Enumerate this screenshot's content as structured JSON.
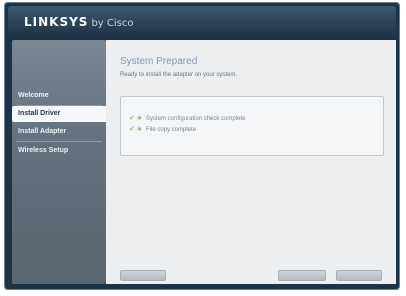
{
  "brand": {
    "logo_text": "LINKSYS",
    "logo_sub": "by Cisco"
  },
  "sidebar": {
    "items": [
      {
        "label": "Welcome"
      },
      {
        "label": "Install Driver"
      },
      {
        "label": "Install Adapter"
      },
      {
        "label": "Wireless Setup"
      }
    ]
  },
  "main": {
    "title": "System Prepared",
    "subtitle": "Ready to install the adapter on your system.",
    "status_items": [
      {
        "text": "System configuration check complete"
      },
      {
        "text": "File copy complete"
      }
    ]
  },
  "colors": {
    "accent": "#7f9bb6",
    "frame": "#1f3346",
    "check": "#9db86e"
  },
  "icons": {
    "check": "check-icon",
    "bullet": "bullet-icon"
  }
}
